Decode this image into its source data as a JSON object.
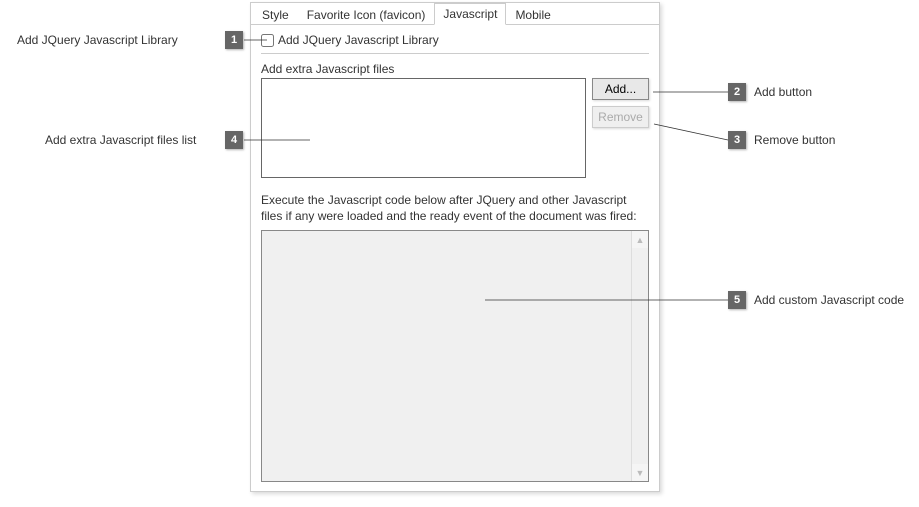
{
  "tabs": {
    "style": "Style",
    "favicon": "Favorite Icon (favicon)",
    "javascript": "Javascript",
    "mobile": "Mobile"
  },
  "jquery": {
    "checkbox_label": "Add JQuery Javascript Library"
  },
  "extra_files": {
    "label": "Add extra Javascript files",
    "add_button": "Add...",
    "remove_button": "Remove"
  },
  "exec": {
    "label": "Execute the Javascript code below after JQuery and other Javascript files if any were loaded and the ready event of the document was fired:"
  },
  "callouts": {
    "c1": {
      "num": "1",
      "text": "Add JQuery Javascript Library"
    },
    "c2": {
      "num": "2",
      "text": "Add button"
    },
    "c3": {
      "num": "3",
      "text": "Remove button"
    },
    "c4": {
      "num": "4",
      "text": "Add extra Javascript files list"
    },
    "c5": {
      "num": "5",
      "text": "Add custom Javascript code"
    }
  }
}
